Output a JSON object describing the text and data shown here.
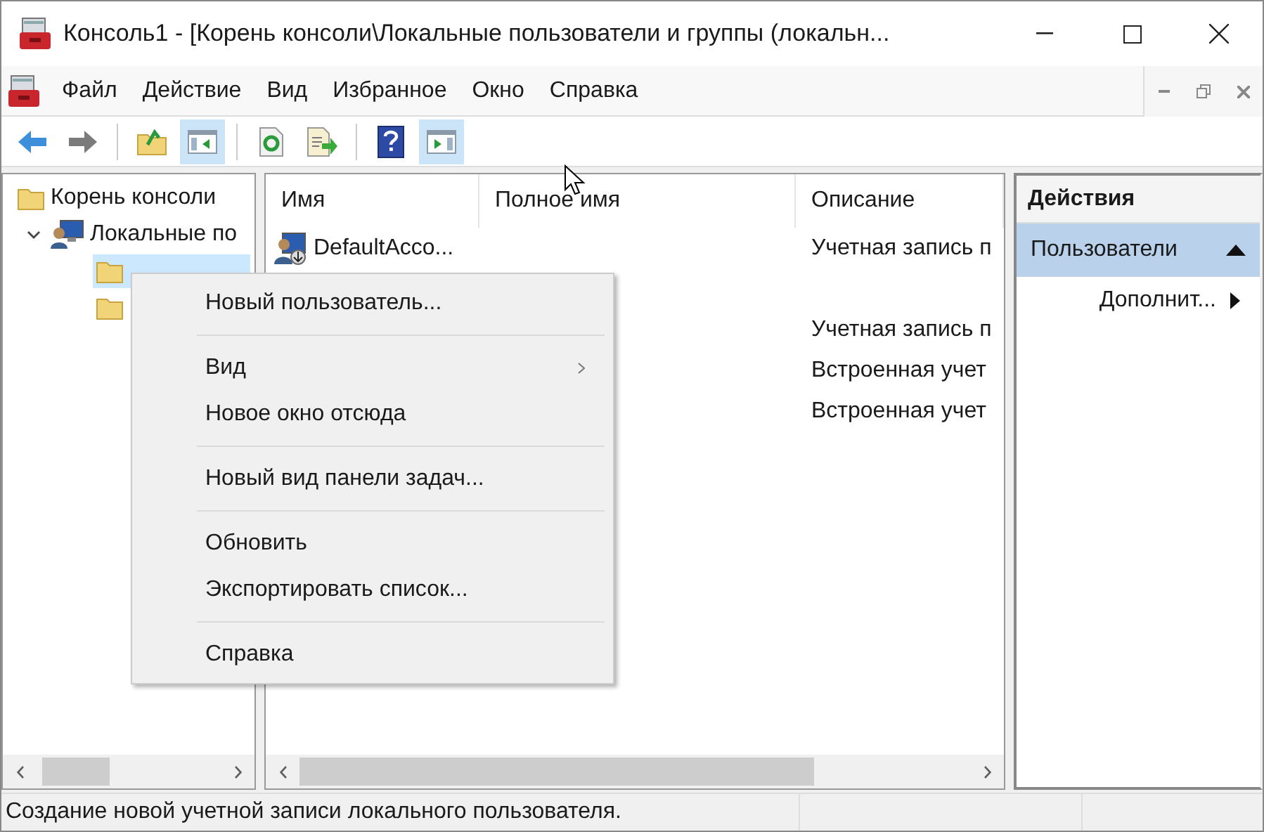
{
  "window": {
    "title": "Консоль1 - [Корень консоли\\Локальные пользователи и группы (локальн..."
  },
  "menu_bar": [
    "Файл",
    "Действие",
    "Вид",
    "Избранное",
    "Окно",
    "Справка"
  ],
  "toolbar": [
    {
      "kind": "back",
      "pressed": false
    },
    {
      "kind": "forward",
      "pressed": false
    },
    {
      "kind": "up",
      "pressed": false
    },
    {
      "kind": "tree",
      "pressed": true
    },
    {
      "kind": "refresh",
      "pressed": false
    },
    {
      "kind": "export",
      "pressed": false
    },
    {
      "kind": "help",
      "pressed": false
    },
    {
      "kind": "actionpane",
      "pressed": true
    }
  ],
  "tree": [
    {
      "label": "Корень консоли",
      "kind": "folder",
      "selected": false,
      "children": [
        {
          "label": "Локальные по",
          "kind": "computer",
          "expanded": true,
          "selected": false,
          "children": [
            {
              "kind": "folder",
              "selected": true
            },
            {
              "kind": "folder",
              "selected": false
            }
          ]
        }
      ]
    }
  ],
  "table": {
    "columns": [
      "Имя",
      "Полное имя",
      "Описание"
    ],
    "rows": [
      {
        "name": "DefaultAcco...",
        "full_name": "",
        "description": "Учетная запись п"
      },
      {
        "name": "",
        "full_name": "",
        "description": ""
      },
      {
        "name": "",
        "full_name": "",
        "description": "Учетная запись п"
      },
      {
        "name": "",
        "full_name": "",
        "description": "Встроенная учет"
      },
      {
        "name": "",
        "full_name": "",
        "description": "Встроенная учет"
      }
    ]
  },
  "actions": {
    "title": "Действия",
    "section": "Пользователи",
    "items": [
      "Дополнит..."
    ]
  },
  "context_menu": [
    {
      "kind": "item",
      "label": "Новый пользователь...",
      "submenu": false
    },
    {
      "kind": "separator"
    },
    {
      "kind": "item",
      "label": "Вид",
      "submenu": true
    },
    {
      "kind": "item",
      "label": "Новое окно отсюда",
      "submenu": false
    },
    {
      "kind": "separator"
    },
    {
      "kind": "item",
      "label": "Новый вид панели задач...",
      "submenu": false
    },
    {
      "kind": "separator"
    },
    {
      "kind": "item",
      "label": "Обновить",
      "submenu": false
    },
    {
      "kind": "item",
      "label": "Экспортировать список...",
      "submenu": false
    },
    {
      "kind": "separator"
    },
    {
      "kind": "item",
      "label": "Справка",
      "submenu": false
    }
  ],
  "status_bar": "Создание новой учетной записи локального пользователя."
}
